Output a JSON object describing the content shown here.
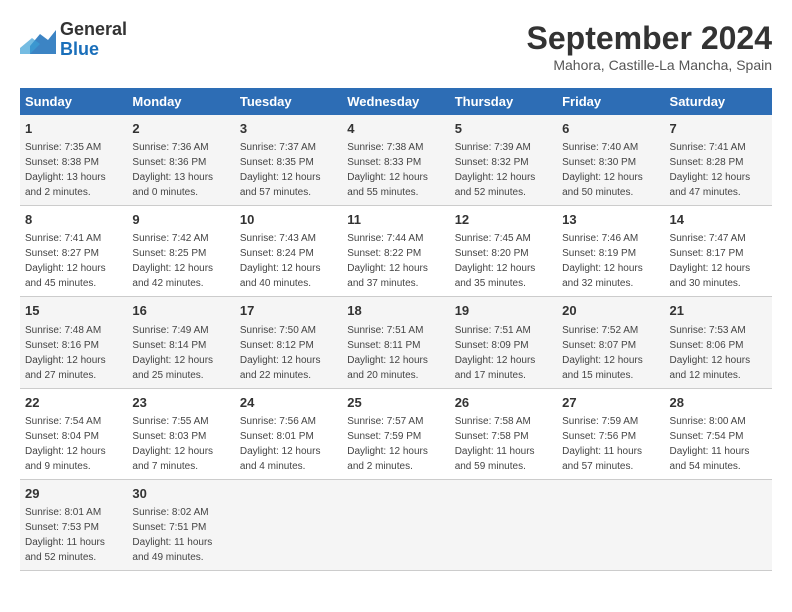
{
  "header": {
    "logo_line1": "General",
    "logo_line2": "Blue",
    "month": "September 2024",
    "location": "Mahora, Castille-La Mancha, Spain"
  },
  "weekdays": [
    "Sunday",
    "Monday",
    "Tuesday",
    "Wednesday",
    "Thursday",
    "Friday",
    "Saturday"
  ],
  "weeks": [
    [
      {
        "day": "1",
        "info": "Sunrise: 7:35 AM\nSunset: 8:38 PM\nDaylight: 13 hours and 2 minutes."
      },
      {
        "day": "2",
        "info": "Sunrise: 7:36 AM\nSunset: 8:36 PM\nDaylight: 13 hours and 0 minutes."
      },
      {
        "day": "3",
        "info": "Sunrise: 7:37 AM\nSunset: 8:35 PM\nDaylight: 12 hours and 57 minutes."
      },
      {
        "day": "4",
        "info": "Sunrise: 7:38 AM\nSunset: 8:33 PM\nDaylight: 12 hours and 55 minutes."
      },
      {
        "day": "5",
        "info": "Sunrise: 7:39 AM\nSunset: 8:32 PM\nDaylight: 12 hours and 52 minutes."
      },
      {
        "day": "6",
        "info": "Sunrise: 7:40 AM\nSunset: 8:30 PM\nDaylight: 12 hours and 50 minutes."
      },
      {
        "day": "7",
        "info": "Sunrise: 7:41 AM\nSunset: 8:28 PM\nDaylight: 12 hours and 47 minutes."
      }
    ],
    [
      {
        "day": "8",
        "info": "Sunrise: 7:41 AM\nSunset: 8:27 PM\nDaylight: 12 hours and 45 minutes."
      },
      {
        "day": "9",
        "info": "Sunrise: 7:42 AM\nSunset: 8:25 PM\nDaylight: 12 hours and 42 minutes."
      },
      {
        "day": "10",
        "info": "Sunrise: 7:43 AM\nSunset: 8:24 PM\nDaylight: 12 hours and 40 minutes."
      },
      {
        "day": "11",
        "info": "Sunrise: 7:44 AM\nSunset: 8:22 PM\nDaylight: 12 hours and 37 minutes."
      },
      {
        "day": "12",
        "info": "Sunrise: 7:45 AM\nSunset: 8:20 PM\nDaylight: 12 hours and 35 minutes."
      },
      {
        "day": "13",
        "info": "Sunrise: 7:46 AM\nSunset: 8:19 PM\nDaylight: 12 hours and 32 minutes."
      },
      {
        "day": "14",
        "info": "Sunrise: 7:47 AM\nSunset: 8:17 PM\nDaylight: 12 hours and 30 minutes."
      }
    ],
    [
      {
        "day": "15",
        "info": "Sunrise: 7:48 AM\nSunset: 8:16 PM\nDaylight: 12 hours and 27 minutes."
      },
      {
        "day": "16",
        "info": "Sunrise: 7:49 AM\nSunset: 8:14 PM\nDaylight: 12 hours and 25 minutes."
      },
      {
        "day": "17",
        "info": "Sunrise: 7:50 AM\nSunset: 8:12 PM\nDaylight: 12 hours and 22 minutes."
      },
      {
        "day": "18",
        "info": "Sunrise: 7:51 AM\nSunset: 8:11 PM\nDaylight: 12 hours and 20 minutes."
      },
      {
        "day": "19",
        "info": "Sunrise: 7:51 AM\nSunset: 8:09 PM\nDaylight: 12 hours and 17 minutes."
      },
      {
        "day": "20",
        "info": "Sunrise: 7:52 AM\nSunset: 8:07 PM\nDaylight: 12 hours and 15 minutes."
      },
      {
        "day": "21",
        "info": "Sunrise: 7:53 AM\nSunset: 8:06 PM\nDaylight: 12 hours and 12 minutes."
      }
    ],
    [
      {
        "day": "22",
        "info": "Sunrise: 7:54 AM\nSunset: 8:04 PM\nDaylight: 12 hours and 9 minutes."
      },
      {
        "day": "23",
        "info": "Sunrise: 7:55 AM\nSunset: 8:03 PM\nDaylight: 12 hours and 7 minutes."
      },
      {
        "day": "24",
        "info": "Sunrise: 7:56 AM\nSunset: 8:01 PM\nDaylight: 12 hours and 4 minutes."
      },
      {
        "day": "25",
        "info": "Sunrise: 7:57 AM\nSunset: 7:59 PM\nDaylight: 12 hours and 2 minutes."
      },
      {
        "day": "26",
        "info": "Sunrise: 7:58 AM\nSunset: 7:58 PM\nDaylight: 11 hours and 59 minutes."
      },
      {
        "day": "27",
        "info": "Sunrise: 7:59 AM\nSunset: 7:56 PM\nDaylight: 11 hours and 57 minutes."
      },
      {
        "day": "28",
        "info": "Sunrise: 8:00 AM\nSunset: 7:54 PM\nDaylight: 11 hours and 54 minutes."
      }
    ],
    [
      {
        "day": "29",
        "info": "Sunrise: 8:01 AM\nSunset: 7:53 PM\nDaylight: 11 hours and 52 minutes."
      },
      {
        "day": "30",
        "info": "Sunrise: 8:02 AM\nSunset: 7:51 PM\nDaylight: 11 hours and 49 minutes."
      },
      {
        "day": "",
        "info": ""
      },
      {
        "day": "",
        "info": ""
      },
      {
        "day": "",
        "info": ""
      },
      {
        "day": "",
        "info": ""
      },
      {
        "day": "",
        "info": ""
      }
    ]
  ]
}
